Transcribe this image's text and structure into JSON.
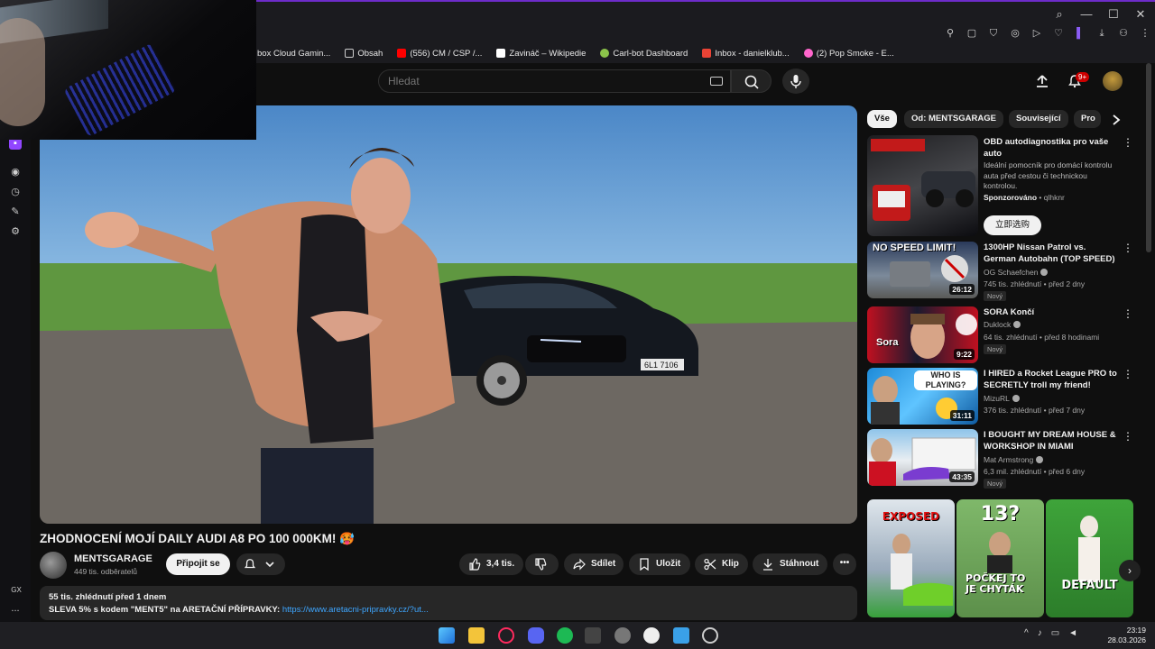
{
  "bookmarks": [
    {
      "label": "box Cloud Gamin...",
      "color": "#2e2e2e"
    },
    {
      "label": "Obsah",
      "color": "#cfcfcf"
    },
    {
      "label": "(556) CM / CSP /...",
      "color": "#ff0000"
    },
    {
      "label": "Zavináč – Wikipedie",
      "color": "#ffffff"
    },
    {
      "label": "Carl-bot Dashboard",
      "color": "#8bc34a"
    },
    {
      "label": "Inbox - danielklub...",
      "color": "#ea4335"
    },
    {
      "label": "(2) Pop Smoke - E...",
      "color": "#ff66cc"
    }
  ],
  "sidebar_letters": {
    "gx": "GX",
    "more": "..."
  },
  "header": {
    "search_placeholder": "Hledat",
    "notif_badge": "9+"
  },
  "video": {
    "title": "ZHODNOCENÍ MOJÍ DAILY AUDI A8 PO 100 000KM! 🥵",
    "plate": "6L1 7106",
    "channel": {
      "name": "MENTSGARAGE",
      "subs": "449 tis. odběratelů"
    },
    "join_label": "Připojit se",
    "actions": {
      "likes": "3,4 tis.",
      "share": "Sdílet",
      "save": "Uložit",
      "clip": "Klip",
      "download": "Stáhnout"
    },
    "description": {
      "meta": "55 tis. zhlédnutí  před 1 dnem",
      "line_prefix": "SLEVA 5% s kodem \"MENT5\"  na ARETAČNÍ PŘÍPRAVKY: ",
      "link": "https://www.aretacni-pripravky.cz/?ut..."
    }
  },
  "chips": [
    "Vše",
    "Od: MENTSGARAGE",
    "Související",
    "Pro"
  ],
  "related": [
    {
      "title": "OBD autodiagnostika pro vaše auto",
      "desc": "Ideální pomocník pro domácí kontrolu auta před cestou či technickou kontrolou.",
      "sponsor_label": "Sponzorováno",
      "sponsor_name": "qlhknr",
      "cta": "立即选购"
    },
    {
      "title": "1300HP Nissan Patrol vs. German Autobahn (TOP SPEED)",
      "channel": "OG Schaefchen",
      "meta": "745 tis. zhlédnutí • před 2 dny",
      "duration": "26:12",
      "badge": "Nový",
      "thumb_text": "NO SPEED LIMIT!"
    },
    {
      "title": "SORA Končí",
      "channel": "Duklock",
      "meta": "64 tis. zhlédnutí • před 8 hodinami",
      "duration": "9:22",
      "badge": "Nový",
      "thumb_text": "Sora"
    },
    {
      "title": "I HIRED a Rocket League PRO to SECRETLY troll my friend!",
      "channel": "MizuRL",
      "meta": "376 tis. zhlédnutí • před 7 dny",
      "duration": "31:11",
      "thumb_text": "WHO IS PLAYING?"
    },
    {
      "title": "I BOUGHT MY DREAM HOUSE & WORKSHOP IN MIAMI",
      "channel": "Mat Armstrong",
      "meta": "6,3 mil. zhlédnutí • před 6 dny",
      "duration": "43:35",
      "badge": "Nový"
    }
  ],
  "shorts": [
    {
      "text": "EXPOSED"
    },
    {
      "text": "13?",
      "text2": "POČKEJ TO JE CHYTÁK"
    },
    {
      "text": "DEFAULT"
    }
  ],
  "clock": {
    "time": "23:19",
    "date": "28.03.2026"
  }
}
